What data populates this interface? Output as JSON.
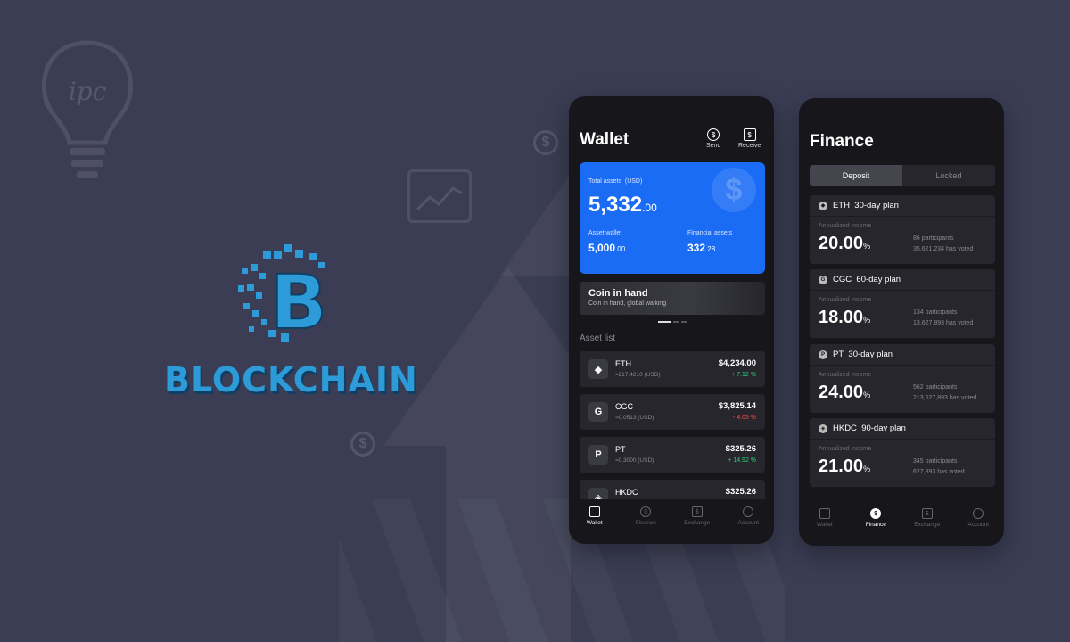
{
  "colors": {
    "background": "#3b3d54",
    "accent_blue": "#1a6cf5",
    "logo_blue": "#2c9bd8",
    "up": "#2fd07a",
    "down": "#ff4d4d"
  },
  "logos": {
    "ipc": "ipc",
    "brand": "BLOCKCHAIN",
    "brand_glyph": "B"
  },
  "wallet_screen": {
    "title": "Wallet",
    "send_label": "Send",
    "receive_label": "Receive",
    "assets_card": {
      "total_label": "Total assets",
      "total_unit": "(USD)",
      "total_main": "5,332",
      "total_dec": ".00",
      "wallet_label": "Asset wallet",
      "wallet_main": "5,000",
      "wallet_dec": ".00",
      "financial_label": "Financial assets",
      "financial_main": "332",
      "financial_dec": ".28"
    },
    "banner": {
      "title": "Coin in hand",
      "subtitle": "Coin in hand, global walking"
    },
    "asset_list_label": "Asset list",
    "assets": [
      {
        "symbol": "ETH",
        "icon": "eth-icon",
        "glyph": "◆",
        "qty": "≈217.4210 (USD)",
        "price": "$4,234.00",
        "change": "+ 7.12 %",
        "direction": "up"
      },
      {
        "symbol": "CGC",
        "icon": "cgc-icon",
        "glyph": "G",
        "qty": "≈0.0513 (USD)",
        "price": "$3,825.14",
        "change": "- 4.05 %",
        "direction": "down"
      },
      {
        "symbol": "PT",
        "icon": "pt-icon",
        "glyph": "P",
        "qty": "≈0.3000 (USD)",
        "price": "$325.26",
        "change": "+ 14.92 %",
        "direction": "up"
      },
      {
        "symbol": "HKDC",
        "icon": "hkdc-icon",
        "glyph": "◈",
        "qty": "",
        "price": "$325.26",
        "change": "",
        "direction": "up"
      }
    ],
    "nav": [
      "Wallet",
      "Finance",
      "Exchange",
      "Account"
    ],
    "nav_active": "Wallet"
  },
  "finance_screen": {
    "title": "Finance",
    "tabs": [
      "Deposit",
      "Locked"
    ],
    "active_tab": "Deposit",
    "annualized_label": "Annualized income",
    "plans": [
      {
        "coin": "ETH",
        "glyph": "◆",
        "term": "30-day plan",
        "rate": "20.00",
        "participants": "86 participants",
        "votes": "35,621,234 has voted"
      },
      {
        "coin": "CGC",
        "glyph": "G",
        "term": "60-day plan",
        "rate": "18.00",
        "participants": "134 participants",
        "votes": "13,627,893 has voted"
      },
      {
        "coin": "PT",
        "glyph": "P",
        "term": "30-day plan",
        "rate": "24.00",
        "participants": "562 participants",
        "votes": "213,627,893 has voted"
      },
      {
        "coin": "HKDC",
        "glyph": "◈",
        "term": "90-day plan",
        "rate": "21.00",
        "participants": "345 participants",
        "votes": "627,893 has voted"
      }
    ],
    "percent_sign": "%",
    "nav": [
      "Wallet",
      "Finance",
      "Exchange",
      "Account"
    ],
    "nav_active": "Finance"
  }
}
